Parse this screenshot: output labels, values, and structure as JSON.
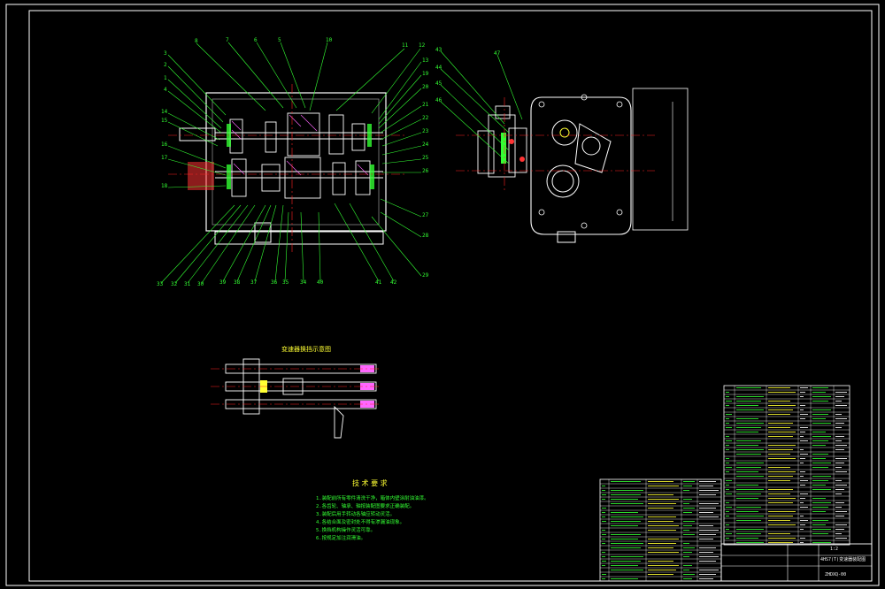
{
  "drawing": {
    "section_view_title": "变速器换挡示意图",
    "requirements_title": "技 术 要 求",
    "requirements": [
      "1.装配前所有零件清洗干净，箱体内壁涂耐油油漆。",
      "2.各齿轮、轴承、轴按装配图要求正确装配。",
      "3.装配后用手转动各轴应转动灵活。",
      "4.各结合面及密封处不得有渗漏油现象。",
      "5.换挡机构操作灵活可靠。",
      "6.按规定加注润滑油。"
    ],
    "main_view_top_labels": [
      "8",
      "7",
      "6",
      "5",
      "10",
      "11",
      "12"
    ],
    "main_view_left_labels": [
      "3",
      "2",
      "1",
      "4",
      "14",
      "15",
      "16",
      "17",
      "18"
    ],
    "main_view_right_labels": [
      "13",
      "19",
      "20",
      "21",
      "22",
      "23",
      "24",
      "25",
      "26",
      "27",
      "28",
      "29"
    ],
    "main_view_bottom_labels": [
      "33",
      "32",
      "31",
      "30",
      "39",
      "38",
      "37",
      "36",
      "35",
      "34",
      "40",
      "41",
      "42"
    ],
    "side_view_labels": [
      "43",
      "44",
      "45",
      "46",
      "47"
    ],
    "title_block": {
      "drawing_name": "4HS7(T)变速器装配图",
      "scale": "1:2",
      "drawing_number": "ZHDXQ-00"
    },
    "colors": {
      "background": "#000000",
      "outline": "#ffffff",
      "leader": "#33ff33",
      "centerline": "#ff2222",
      "part_detail": "#ff66ff",
      "highlight": "#ffff33"
    }
  }
}
